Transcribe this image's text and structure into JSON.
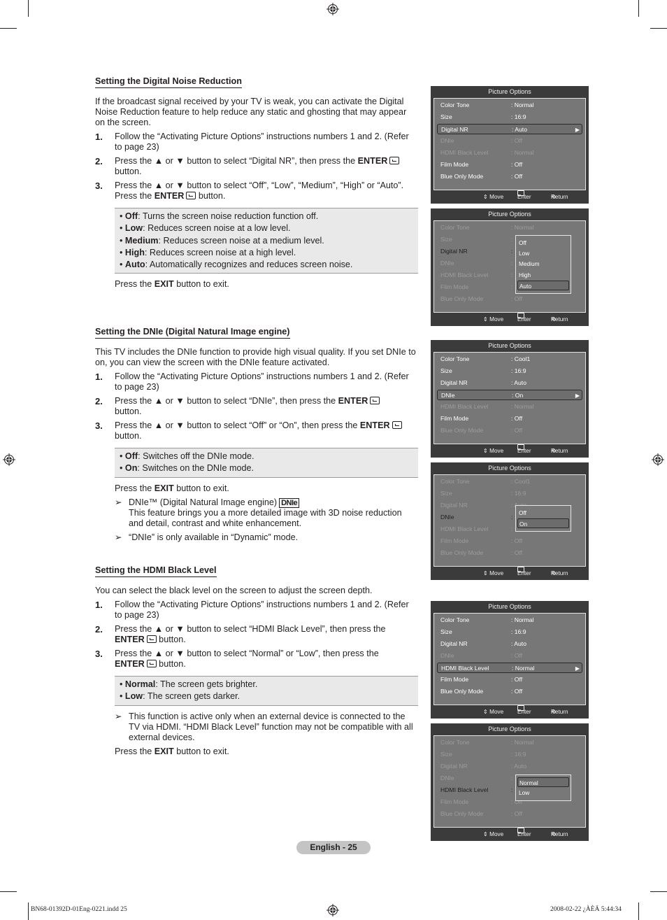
{
  "sections": [
    {
      "heading": "Setting the Digital Noise Reduction",
      "intro": "If the broadcast signal received by your TV is weak, you can activate the Digital Noise Reduction feature to help reduce any static and ghosting that may appear on the screen.",
      "steps": [
        {
          "num": "1.",
          "text": "Follow the “Activating Picture Options” instructions numbers 1 and 2. (Refer to page 23)"
        },
        {
          "num": "2.",
          "pre": "Press the ▲ or ▼ button to select “Digital NR”, then press the ",
          "key": "ENTER",
          "post": " button."
        },
        {
          "num": "3.",
          "pre": "Press the ▲ or ▼ button to select “Off”, “Low”, “Medium”, “High” or “Auto”. Press the ",
          "key": "ENTER",
          "post": " button."
        }
      ],
      "options": [
        {
          "term": "Off",
          "desc": ": Turns the screen noise reduction function off."
        },
        {
          "term": "Low",
          "desc": ": Reduces screen noise at a low level."
        },
        {
          "term": "Medium",
          "desc": ": Reduces screen noise at a medium level."
        },
        {
          "term": "High",
          "desc": ": Reduces screen noise at a high level."
        },
        {
          "term": "Auto",
          "desc": ": Automatically recognizes and reduces screen noise."
        }
      ],
      "exit": {
        "pre": "Press the ",
        "key": "EXIT",
        "post": " button to exit."
      }
    },
    {
      "heading": "Setting the DNIe (Digital Natural Image engine)",
      "intro": "This TV includes the DNIe function to provide high visual quality. If you set DNIe to on, you can view the screen with the DNIe feature activated.",
      "steps": [
        {
          "num": "1.",
          "text": "Follow the “Activating Picture Options” instructions numbers 1 and 2. (Refer to page 23)"
        },
        {
          "num": "2.",
          "pre": "Press the ▲ or ▼ button to select “DNIe”, then press the ",
          "key": "ENTER",
          "post": " button."
        },
        {
          "num": "3.",
          "pre": "Press the ▲ or ▼ button to select “Off” or “On”, then press the ",
          "key": "ENTER",
          "post": " button."
        }
      ],
      "options": [
        {
          "term": "Off",
          "desc": ": Switches off the DNIe mode."
        },
        {
          "term": "On",
          "desc": ": Switches on the DNIe mode."
        }
      ],
      "exit": {
        "pre": "Press the ",
        "key": "EXIT",
        "post": " button to exit."
      },
      "notes": [
        {
          "line1": "DNIe™ (Digital Natural Image engine)",
          "logo": "DNIe",
          "line2": "This feature brings you a more detailed image with 3D noise reduction and detail, contrast and white enhancement."
        },
        {
          "line1": "“DNIe” is only available in “Dynamic” mode."
        }
      ]
    },
    {
      "heading": "Setting the HDMI Black Level",
      "intro": "You can select the black level on the screen to adjust the screen depth.",
      "steps": [
        {
          "num": "1.",
          "text": "Follow the “Activating Picture Options” instructions numbers 1 and 2. (Refer to page 23)"
        },
        {
          "num": "2.",
          "pre": "Press the ▲ or ▼ button to select “HDMI Black Level”, then press the ",
          "key": "ENTER",
          "post": " button."
        },
        {
          "num": "3.",
          "pre": "Press the ▲ or ▼ button to select “Normal” or “Low”, then press the ",
          "key": "ENTER",
          "post": " button."
        }
      ],
      "options": [
        {
          "term": "Normal",
          "desc": ": The screen gets brighter."
        },
        {
          "term": "Low",
          "desc": ": The screen gets darker."
        }
      ],
      "notes": [
        {
          "line1": "This function is active only when an external device is connected to the TV via HDMI. “HDMI Black Level” function may not be compatible with all external devices."
        }
      ],
      "exit": {
        "pre": "Press the ",
        "key": "EXIT",
        "post": " button to exit."
      }
    }
  ],
  "arrow_glyph": "➢",
  "menus": [
    {
      "title": "Picture Options",
      "rows": [
        {
          "label": "Color Tone",
          "value": ": Normal",
          "state": "normal"
        },
        {
          "label": "Size",
          "value": ": 16:9",
          "state": "normal"
        },
        {
          "label": "Digital NR",
          "value": ": Auto",
          "state": "selected"
        },
        {
          "label": "DNIe",
          "value": ": Off",
          "state": "dim"
        },
        {
          "label": "HDMI Black Level",
          "value": ": Normal",
          "state": "dim"
        },
        {
          "label": "Film Mode",
          "value": ": Off",
          "state": "normal"
        },
        {
          "label": "Blue Only Mode",
          "value": ": Off",
          "state": "normal"
        }
      ],
      "footer": {
        "move": "⇕ Move",
        "enter": "Enter",
        "return": "Return"
      }
    },
    {
      "title": "Picture Options",
      "rows": [
        {
          "label": "Color Tone",
          "value": ": Normal",
          "state": "dim"
        },
        {
          "label": "Size",
          "value": ":",
          "state": "dim"
        },
        {
          "label": "Digital NR",
          "value": ":",
          "state": "active"
        },
        {
          "label": "DNIe",
          "value": ":",
          "state": "dim"
        },
        {
          "label": "HDMI Black Level",
          "value": ":",
          "state": "dim"
        },
        {
          "label": "Film Mode",
          "value": ":",
          "state": "dim"
        },
        {
          "label": "Blue Only Mode",
          "value": ": Off",
          "state": "dim"
        }
      ],
      "popup": {
        "options": [
          "Off",
          "Low",
          "Medium",
          "High",
          "Auto"
        ],
        "selected": "Auto"
      },
      "footer": {
        "move": "⇕ Move",
        "enter": "Enter",
        "return": "Return"
      }
    },
    {
      "title": "Picture Options",
      "rows": [
        {
          "label": "Color Tone",
          "value": ": Cool1",
          "state": "normal"
        },
        {
          "label": "Size",
          "value": ": 16:9",
          "state": "normal"
        },
        {
          "label": "Digital NR",
          "value": ": Auto",
          "state": "normal"
        },
        {
          "label": "DNIe",
          "value": ": On",
          "state": "selected"
        },
        {
          "label": "HDMI Black Level",
          "value": ": Normal",
          "state": "dim"
        },
        {
          "label": "Film Mode",
          "value": ": Off",
          "state": "normal"
        },
        {
          "label": "Blue Only Mode",
          "value": ": Off",
          "state": "dim"
        }
      ],
      "footer": {
        "move": "⇕ Move",
        "enter": "Enter",
        "return": "Return"
      }
    },
    {
      "title": "Picture Options",
      "rows": [
        {
          "label": "Color Tone",
          "value": ": Cool1",
          "state": "dim"
        },
        {
          "label": "Size",
          "value": ": 16:9",
          "state": "dim"
        },
        {
          "label": "Digital NR",
          "value": ": Auto",
          "state": "dim"
        },
        {
          "label": "DNIe",
          "value": ":",
          "state": "active"
        },
        {
          "label": "HDMI Black Level",
          "value": ":",
          "state": "dim"
        },
        {
          "label": "Film Mode",
          "value": ": Off",
          "state": "dim"
        },
        {
          "label": "Blue Only Mode",
          "value": ": Off",
          "state": "dim"
        }
      ],
      "popup": {
        "options": [
          "Off",
          "On"
        ],
        "selected": "On"
      },
      "footer": {
        "move": "⇕ Move",
        "enter": "Enter",
        "return": "Return"
      }
    },
    {
      "title": "Picture Options",
      "rows": [
        {
          "label": "Color Tone",
          "value": ": Normal",
          "state": "normal"
        },
        {
          "label": "Size",
          "value": ": 16:9",
          "state": "normal"
        },
        {
          "label": "Digital NR",
          "value": ": Auto",
          "state": "normal"
        },
        {
          "label": "DNIe",
          "value": ": Off",
          "state": "dim"
        },
        {
          "label": "HDMI Black Level",
          "value": ": Normal",
          "state": "selected"
        },
        {
          "label": "Film Mode",
          "value": ": Off",
          "state": "normal"
        },
        {
          "label": "Blue Only Mode",
          "value": ": Off",
          "state": "normal"
        }
      ],
      "footer": {
        "move": "⇕ Move",
        "enter": "Enter",
        "return": "Return"
      }
    },
    {
      "title": "Picture Options",
      "rows": [
        {
          "label": "Color Tone",
          "value": ": Normal",
          "state": "dim"
        },
        {
          "label": "Size",
          "value": ": 16:9",
          "state": "dim"
        },
        {
          "label": "Digital NR",
          "value": ": Auto",
          "state": "dim"
        },
        {
          "label": "DNIe",
          "value": ":",
          "state": "dim"
        },
        {
          "label": "HDMI Black Level",
          "value": ":",
          "state": "active"
        },
        {
          "label": "Film Mode",
          "value": ": Off",
          "state": "dim"
        },
        {
          "label": "Blue Only Mode",
          "value": ": Off",
          "state": "dim"
        }
      ],
      "popup": {
        "options": [
          "Normal",
          "Low"
        ],
        "selected": "Normal"
      },
      "footer": {
        "move": "⇕ Move",
        "enter": "Enter",
        "return": "Return"
      }
    }
  ],
  "page_label": "English - 25",
  "slug": {
    "left": "BN68-01392D-01Eng-0221.indd   25",
    "right": "2008-02-22   ¿ÀÈÄ 5:44:34"
  },
  "colors": {
    "menu_bg": "#3b3b3b",
    "menu_panel": "#777777",
    "menu_dim_text": "#9c9c9c",
    "option_box": "#e9e9e9",
    "page_pill": "#c4c4c4"
  }
}
